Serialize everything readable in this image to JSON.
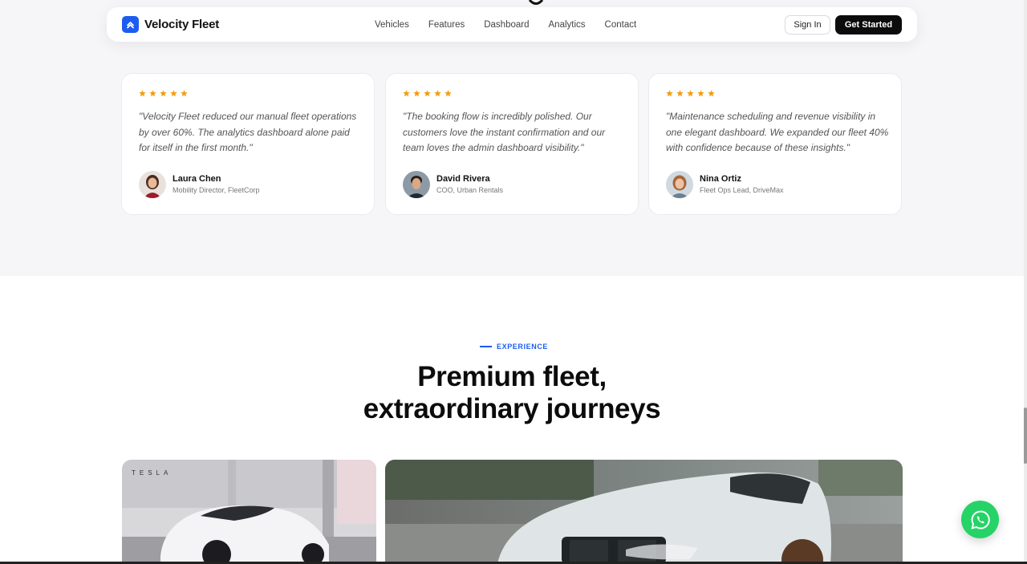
{
  "brand": {
    "name": "Velocity Fleet"
  },
  "nav": {
    "links": [
      "Vehicles",
      "Features",
      "Dashboard",
      "Analytics",
      "Contact"
    ],
    "sign_in": "Sign In",
    "get_started": "Get Started"
  },
  "testimonials": [
    {
      "rating": 5,
      "quote": "\"Velocity Fleet reduced our manual fleet operations by over 60%. The analytics dashboard alone paid for itself in the first month.\"",
      "name": "Laura Chen",
      "role": "Mobility Director, FleetCorp"
    },
    {
      "rating": 5,
      "quote": "\"The booking flow is incredibly polished. Our customers love the instant confirmation and our team loves the admin dashboard visibility.\"",
      "name": "David Rivera",
      "role": "COO, Urban Rentals"
    },
    {
      "rating": 5,
      "quote": "\"Maintenance scheduling and revenue visibility in one elegant dashboard. We expanded our fleet 40% with confidence because of these insights.\"",
      "name": "Nina Ortiz",
      "role": "Fleet Ops Lead, DriveMax"
    }
  ],
  "experience": {
    "eyebrow": "EXPERIENCE",
    "headline_line1": "Premium fleet,",
    "headline_line2": "extraordinary journeys"
  },
  "gallery": {
    "photo1_sign": "TESLA"
  },
  "colors": {
    "accent": "#1d5cf0",
    "star": "#f59e0b",
    "whatsapp": "#25d366"
  },
  "icons": {
    "brand_logo": "chevron-up-icon",
    "star": "star-icon",
    "whatsapp": "whatsapp-icon"
  }
}
